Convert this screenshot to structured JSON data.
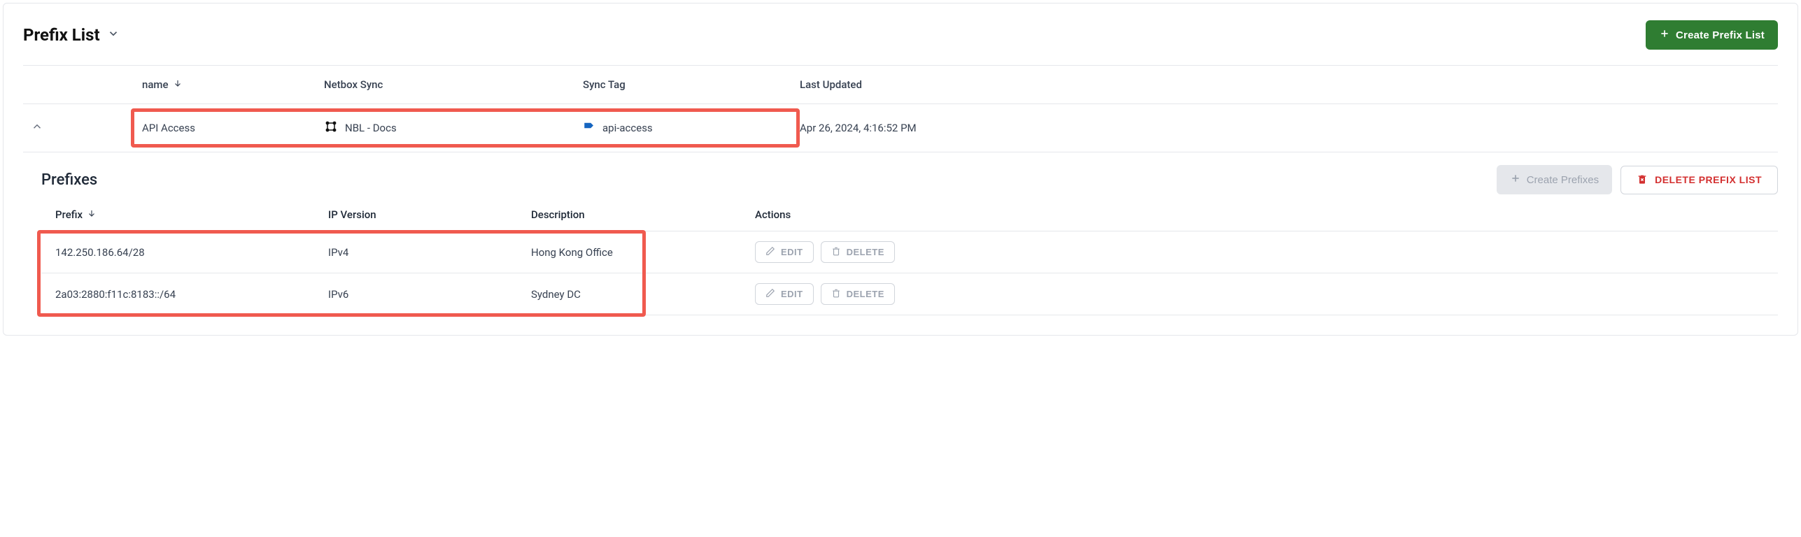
{
  "header": {
    "title": "Prefix List",
    "create_label": "Create Prefix List"
  },
  "columns": {
    "name": "name",
    "netbox_sync": "Netbox Sync",
    "sync_tag": "Sync Tag",
    "last_updated": "Last Updated"
  },
  "row": {
    "name": "API Access",
    "netbox_sync": "NBL - Docs",
    "sync_tag": "api-access",
    "last_updated": "Apr 26, 2024, 4:16:52 PM"
  },
  "sub": {
    "title": "Prefixes",
    "create_label": "Create Prefixes",
    "delete_label": "DELETE PREFIX LIST"
  },
  "sub_columns": {
    "prefix": "Prefix",
    "ip_version": "IP Version",
    "description": "Description",
    "actions": "Actions"
  },
  "action_labels": {
    "edit": "EDIT",
    "delete": "DELETE"
  },
  "prefixes": [
    {
      "prefix": "142.250.186.64/28",
      "ip_version": "IPv4",
      "description": "Hong Kong Office"
    },
    {
      "prefix": "2a03:2880:f11c:8183::/64",
      "ip_version": "IPv6",
      "description": "Sydney DC"
    }
  ]
}
